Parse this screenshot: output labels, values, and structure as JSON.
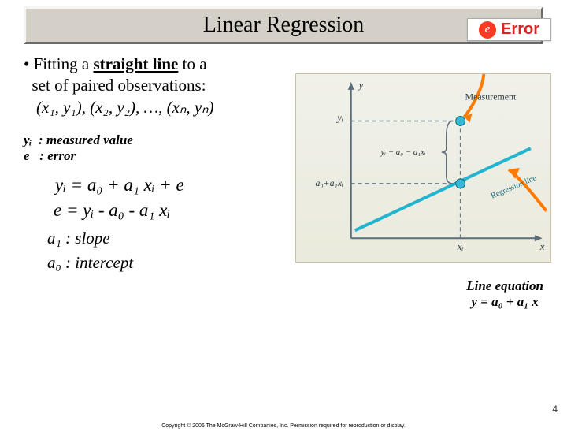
{
  "title": "Linear Regression",
  "bullet": {
    "l1a": "Fitting a ",
    "l1b": "straight line",
    "l1c": " to a",
    "l2": "set of paired observations:",
    "obs": "(x₁, y₁), (x₂, y₂), …, (xₙ, yₙ)"
  },
  "defs": {
    "yi_label": "yᵢ  : measured value",
    "e_label": "e   : error"
  },
  "eq1": "yᵢ = a₀ + a₁ xᵢ + e",
  "eq2": "e  =  yᵢ - a₀ - a₁ xᵢ",
  "slope": "a₁  : slope",
  "intercept": "a₀ : intercept",
  "error_badge": {
    "sym": "e",
    "label": "Error"
  },
  "figure": {
    "ylab_yi": "yᵢ",
    "ylab_fit": "a₀+a₁xᵢ",
    "resid": "yᵢ − a₀ − a₁xᵢ",
    "meas": "Measurement",
    "reg": "Regression line",
    "xlab_xi": "xᵢ",
    "axis_y": "y",
    "axis_x": "x"
  },
  "line_eq_note": {
    "l1": "Line equation",
    "l2": "y = a₀ + a₁ x"
  },
  "slide_number": "4",
  "copyright": "Copyright © 2006 The McGraw-Hill Companies, Inc. Permission required for reproduction or display."
}
